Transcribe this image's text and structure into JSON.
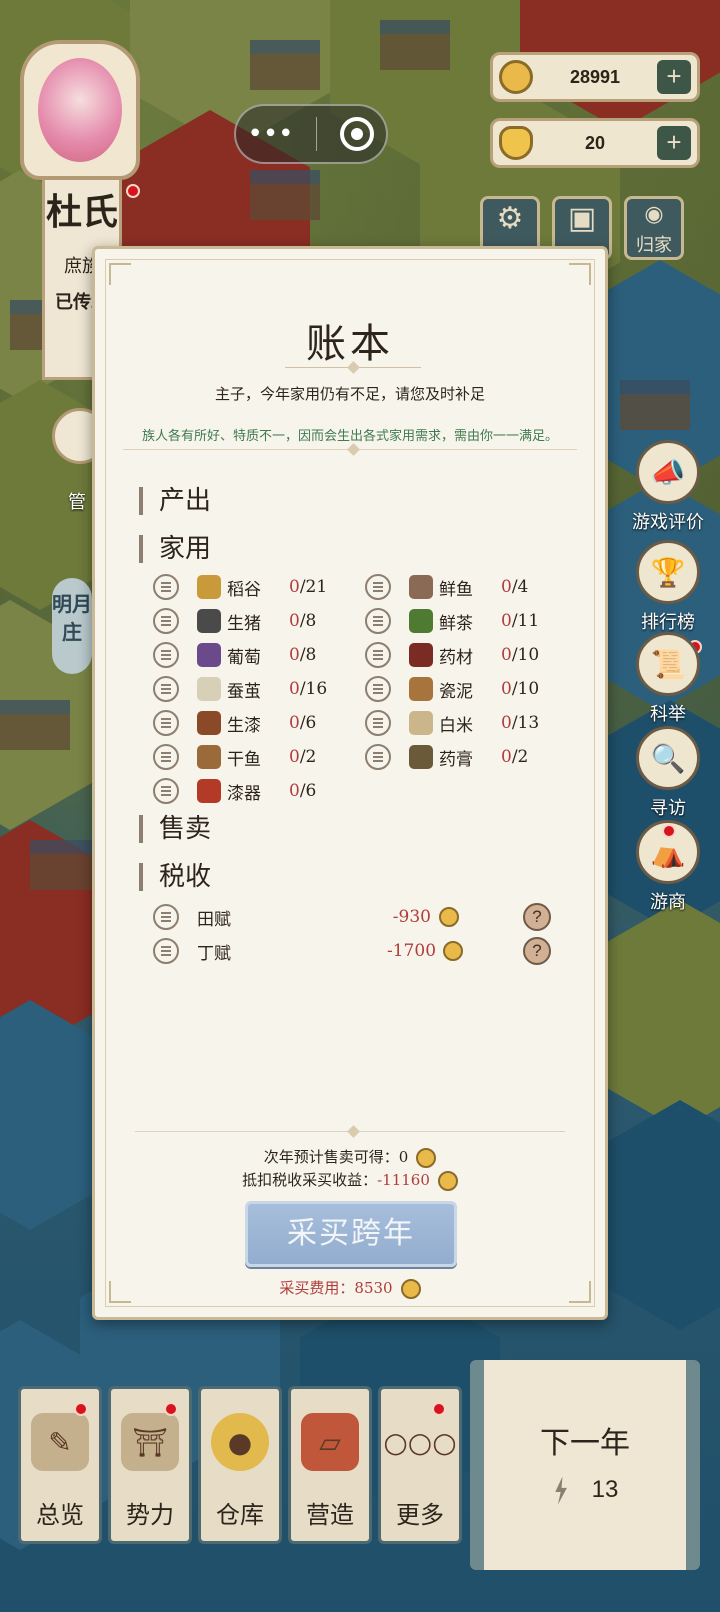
{
  "hud": {
    "player_name": "杜氏",
    "player_clan": "庶族",
    "player_status": "已传承",
    "manager_label": "管",
    "manor_label": "明月庄",
    "coins": "28991",
    "ingots": "20",
    "home_label": "归家"
  },
  "side_buttons": [
    {
      "label": "游戏评价",
      "icon": "megaphone-icon"
    },
    {
      "label": "排行榜",
      "icon": "trophy-icon"
    },
    {
      "label": "科举",
      "icon": "scroll-icon"
    },
    {
      "label": "寻访",
      "icon": "magnifier-icon"
    },
    {
      "label": "游商",
      "icon": "cart-icon"
    }
  ],
  "modal": {
    "title": "账本",
    "subtitle": "主子，今年家用仍有不足，请您及时补足",
    "hint": "族人各有所好、特质不一，因而会生出各式家用需求，需由你一一满足。",
    "sections": {
      "output": "产出",
      "household": "家用",
      "sell": "售卖",
      "tax": "税收"
    },
    "household_items": [
      {
        "name": "稻谷",
        "have": "0",
        "need": "/21",
        "color": "#c99a3a"
      },
      {
        "name": "鲜鱼",
        "have": "0",
        "need": "/4",
        "color": "#8a6a55"
      },
      {
        "name": "生猪",
        "have": "0",
        "need": "/8",
        "color": "#4a4a4a"
      },
      {
        "name": "鲜茶",
        "have": "0",
        "need": "/11",
        "color": "#4f7a32"
      },
      {
        "name": "葡萄",
        "have": "0",
        "need": "/8",
        "color": "#6a4a8a"
      },
      {
        "name": "药材",
        "have": "0",
        "need": "/10",
        "color": "#7a2c24"
      },
      {
        "name": "蚕茧",
        "have": "0",
        "need": "/16",
        "color": "#d8cfb8"
      },
      {
        "name": "瓷泥",
        "have": "0",
        "need": "/10",
        "color": "#a8743e"
      },
      {
        "name": "生漆",
        "have": "0",
        "need": "/6",
        "color": "#8a4a28"
      },
      {
        "name": "白米",
        "have": "0",
        "need": "/13",
        "color": "#cbb58a"
      },
      {
        "name": "干鱼",
        "have": "0",
        "need": "/2",
        "color": "#9a6a3a"
      },
      {
        "name": "药膏",
        "have": "0",
        "need": "/2",
        "color": "#6a5a3a"
      },
      {
        "name": "漆器",
        "have": "0",
        "need": "/6",
        "color": "#b33a26"
      }
    ],
    "taxes": [
      {
        "name": "田赋",
        "value": "-930"
      },
      {
        "name": "丁赋",
        "value": "-1700"
      }
    ],
    "qmark": "?",
    "next_year_sale_label": "次年预计售卖可得：",
    "next_year_sale_value": "0",
    "net_label": "抵扣税收采买收益：",
    "net_value": "-11160",
    "buy_button": "采买跨年",
    "cost_label": "采买费用：",
    "cost_value": "8530"
  },
  "bottom_nav": [
    {
      "label": "总览",
      "icon": "brush-icon",
      "dot": true
    },
    {
      "label": "势力",
      "icon": "palace-icon",
      "dot": true
    },
    {
      "label": "仓库",
      "icon": "sack-icon",
      "dot": false
    },
    {
      "label": "营造",
      "icon": "trowel-icon",
      "dot": false
    },
    {
      "label": "更多",
      "icon": "more-icon",
      "dot": true
    }
  ],
  "next_year": {
    "label": "下一年",
    "energy": "13"
  }
}
